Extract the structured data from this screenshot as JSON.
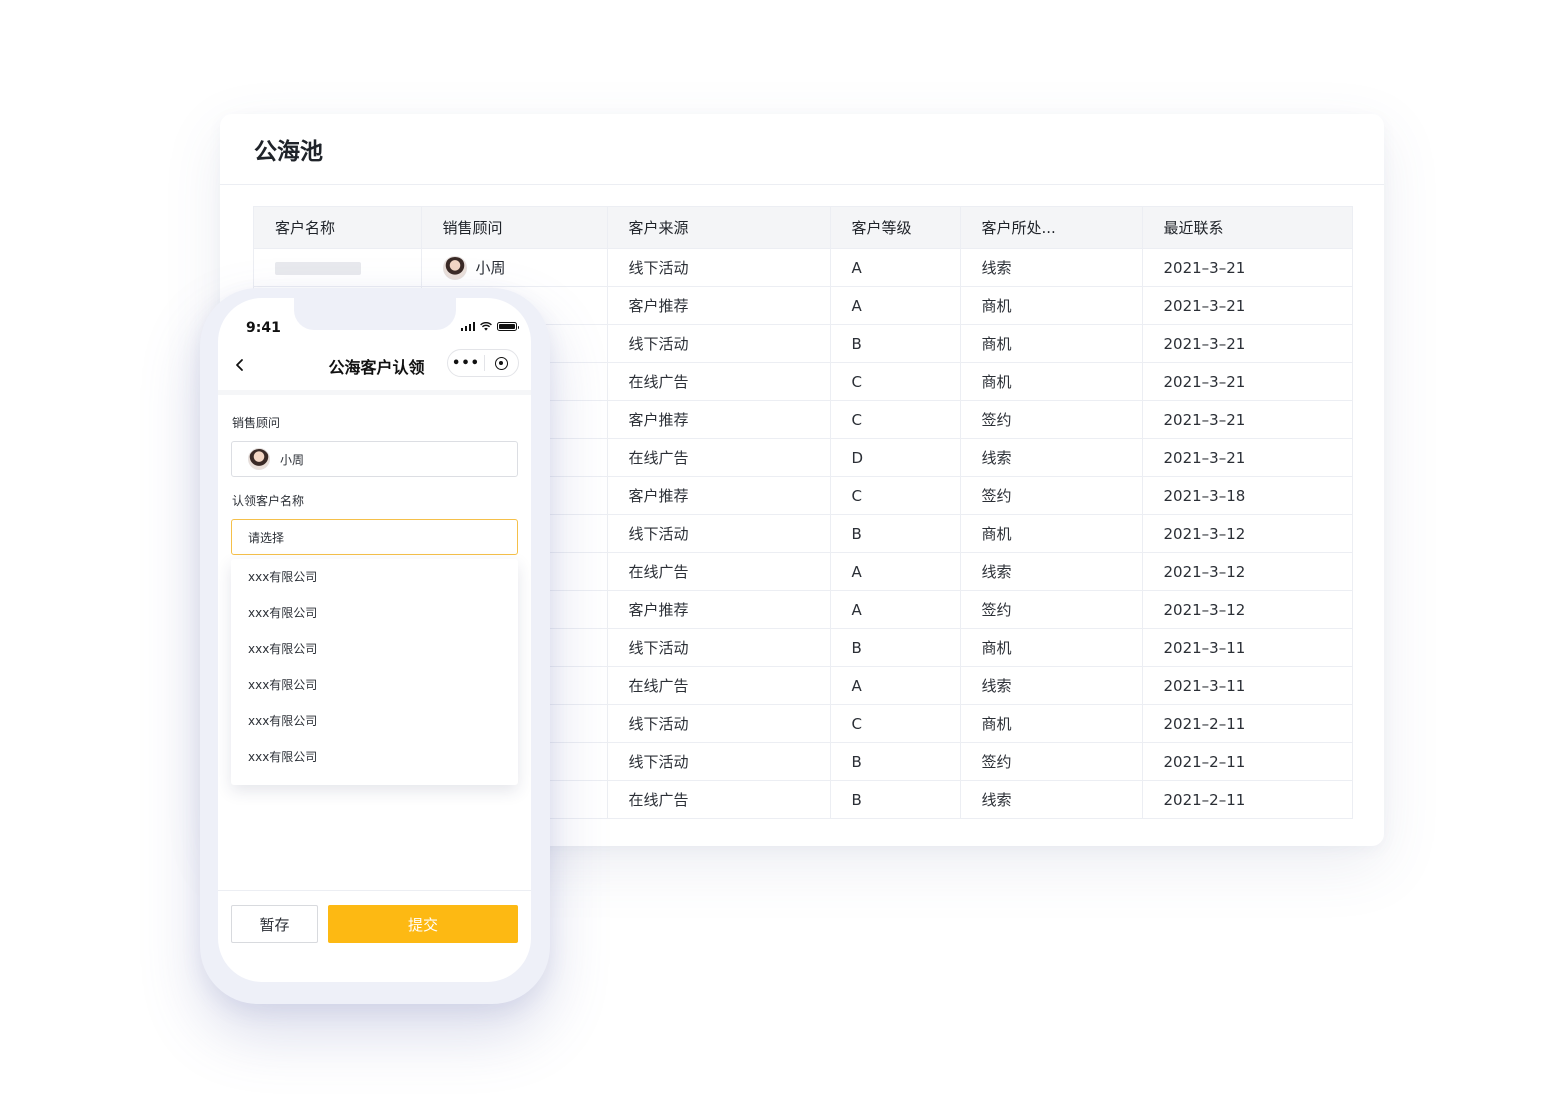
{
  "panel": {
    "title": "公海池"
  },
  "table": {
    "headers": [
      "客户名称",
      "销售顾问",
      "客户来源",
      "客户等级",
      "客户所处...",
      "最近联系"
    ],
    "rows": [
      {
        "advisor": "小周",
        "source": "线下活动",
        "level": "A",
        "stage": "线索",
        "last_contact": "2021–3–21"
      },
      {
        "source": "客户推荐",
        "level": "A",
        "stage": "商机",
        "last_contact": "2021–3–21"
      },
      {
        "source": "线下活动",
        "level": "B",
        "stage": "商机",
        "last_contact": "2021–3–21"
      },
      {
        "source": "在线广告",
        "level": "C",
        "stage": "商机",
        "last_contact": "2021–3–21"
      },
      {
        "source": "客户推荐",
        "level": "C",
        "stage": "签约",
        "last_contact": "2021–3–21"
      },
      {
        "source": "在线广告",
        "level": "D",
        "stage": "线索",
        "last_contact": "2021–3–21"
      },
      {
        "source": "客户推荐",
        "level": "C",
        "stage": "签约",
        "last_contact": "2021–3–18"
      },
      {
        "source": "线下活动",
        "level": "B",
        "stage": "商机",
        "last_contact": "2021–3–12"
      },
      {
        "source": "在线广告",
        "level": "A",
        "stage": "线索",
        "last_contact": "2021–3–12"
      },
      {
        "source": "客户推荐",
        "level": "A",
        "stage": "签约",
        "last_contact": "2021–3–12"
      },
      {
        "source": "线下活动",
        "level": "B",
        "stage": "商机",
        "last_contact": "2021–3–11"
      },
      {
        "source": "在线广告",
        "level": "A",
        "stage": "线索",
        "last_contact": "2021–3–11"
      },
      {
        "source": "线下活动",
        "level": "C",
        "stage": "商机",
        "last_contact": "2021–2–11"
      },
      {
        "source": "线下活动",
        "level": "B",
        "stage": "签约",
        "last_contact": "2021–2–11"
      },
      {
        "source": "在线广告",
        "level": "B",
        "stage": "线索",
        "last_contact": "2021–2–11"
      }
    ]
  },
  "phone": {
    "time": "9:41",
    "nav_title": "公海客户认领",
    "capsule_more": "•••",
    "advisor_label": "销售顾问",
    "advisor_value": "小周",
    "customer_label": "认领客户名称",
    "customer_placeholder": "请选择",
    "options": [
      "xxx有限公司",
      "xxx有限公司",
      "xxx有限公司",
      "xxx有限公司",
      "xxx有限公司",
      "xxx有限公司"
    ],
    "save_label": "暂存",
    "submit_label": "提交"
  },
  "colors": {
    "accent": "#fdb913",
    "active_border": "#f5c04a"
  },
  "icons": [
    "back-arrow-icon",
    "more-dots-icon",
    "close-mini-program-icon",
    "signal-icon",
    "wifi-icon",
    "battery-icon",
    "avatar"
  ]
}
